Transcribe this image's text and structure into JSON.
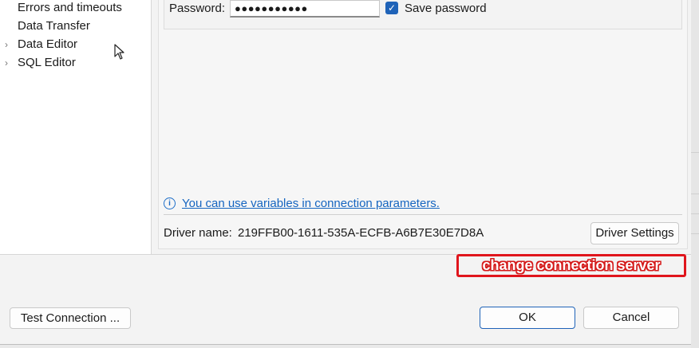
{
  "nav": {
    "items": [
      {
        "label": "Errors and timeouts",
        "expandable": false
      },
      {
        "label": "Data Transfer",
        "expandable": false
      },
      {
        "label": "Data Editor",
        "expandable": true
      },
      {
        "label": "SQL Editor",
        "expandable": true
      }
    ]
  },
  "auth": {
    "password_label": "Password:",
    "password_value": "●●●●●●●●●●●",
    "save_password_label": "Save password",
    "save_password_checked": true
  },
  "info": {
    "link_text": "You can use variables in connection parameters."
  },
  "driver": {
    "name_label": "Driver name:",
    "name_value": "219FFB00-1611-535A-ECFB-A6B7E30E7D8A",
    "settings_button": "Driver Settings"
  },
  "annotation": {
    "text": "change connection server",
    "color": "#e0151c"
  },
  "footer": {
    "test_connection_button": "Test Connection ...",
    "ok_button": "OK",
    "cancel_button": "Cancel"
  },
  "colors": {
    "accent": "#1f63b8",
    "link": "#1565c0"
  }
}
